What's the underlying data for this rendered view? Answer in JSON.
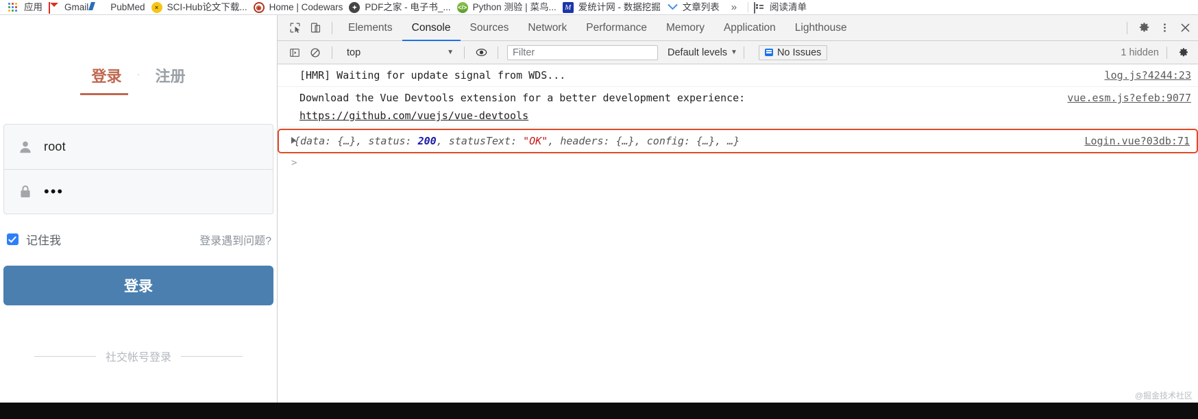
{
  "bookmarks": {
    "items": [
      {
        "label": "应用",
        "icon": "apps-grid-icon"
      },
      {
        "label": "Gmail",
        "icon": "gmail-icon"
      },
      {
        "label": "PubMed",
        "icon": "pubmed-icon"
      },
      {
        "label": "SCI-Hub论文下载...",
        "icon": "scihub-icon"
      },
      {
        "label": "Home | Codewars",
        "icon": "codewars-icon"
      },
      {
        "label": "PDF之家 - 电子书_...",
        "icon": "pdf-icon"
      },
      {
        "label": "Python 测验 | 菜鸟...",
        "icon": "python-icon"
      },
      {
        "label": "爱统计网 - 数据挖掘",
        "icon": "statistics-icon"
      },
      {
        "label": "文章列表",
        "icon": "chevron-down-icon"
      }
    ],
    "overflow_label": "»",
    "reading_list_label": "阅读清单"
  },
  "login_page": {
    "tab_login": "登录",
    "tab_separator": "·",
    "tab_register": "注册",
    "username_value": "root",
    "password_value": "•••",
    "remember_label": "记住我",
    "help_label": "登录遇到问题?",
    "submit_label": "登录",
    "third_party_label": "社交帐号登录",
    "accent_color": "#c0674f",
    "button_color": "#4a7fb0"
  },
  "devtools": {
    "tabs": [
      {
        "label": "Elements",
        "active": false
      },
      {
        "label": "Console",
        "active": true
      },
      {
        "label": "Sources",
        "active": false
      },
      {
        "label": "Network",
        "active": false
      },
      {
        "label": "Performance",
        "active": false
      },
      {
        "label": "Memory",
        "active": false
      },
      {
        "label": "Application",
        "active": false
      },
      {
        "label": "Lighthouse",
        "active": false
      }
    ],
    "icons": {
      "inspect": "inspect-element-icon",
      "device": "device-toolbar-icon",
      "settings": "gear-icon",
      "more": "more-vertical-icon",
      "close": "close-icon"
    },
    "filterbar": {
      "sidebar_toggle": "console-sidebar-icon",
      "clear": "clear-console-icon",
      "context": "top",
      "context_caret": "▼",
      "eye": "live-expression-icon",
      "filter_placeholder": "Filter",
      "filter_value": "",
      "levels_label": "Default levels",
      "levels_caret": "▼",
      "issues_label": "No Issues",
      "hidden_label": "1 hidden",
      "settings": "gear-icon"
    },
    "messages": [
      {
        "kind": "plain",
        "text": "[HMR] Waiting for update signal from WDS...",
        "source": "log.js?4244:23"
      },
      {
        "kind": "multiline",
        "text": "Download the Vue Devtools extension for a better development experience:",
        "link": "https://github.com/vuejs/vue-devtools",
        "source": "vue.esm.js?efeb:9077"
      },
      {
        "kind": "object",
        "prefix": "{data: {…}, status: ",
        "number": "200",
        "mid": ", statusText: ",
        "string": "\"OK\"",
        "suffix": ", headers: {…}, config: {…}, …}",
        "source": "Login.vue?03db:71",
        "highlight_color": "#e04a28"
      }
    ],
    "prompt_symbol": ">"
  },
  "watermark": "@掘金技术社区"
}
